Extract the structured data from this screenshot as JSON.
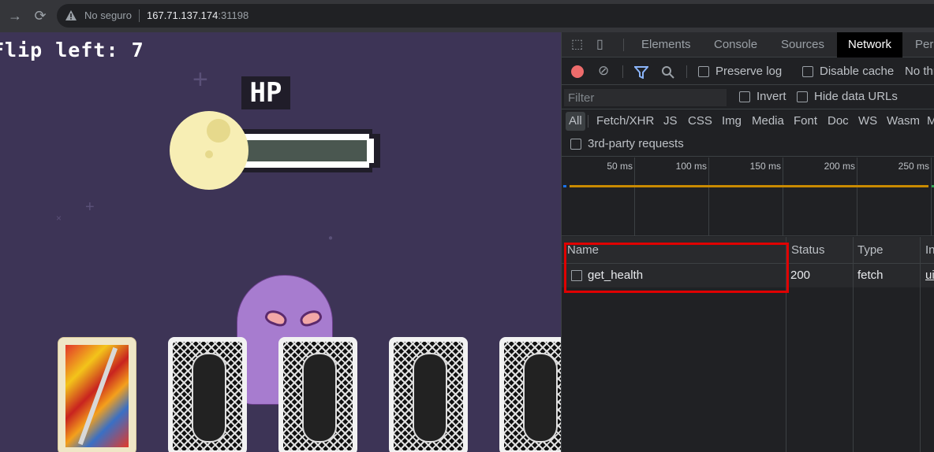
{
  "browser": {
    "security_text": "No seguro",
    "url_host": "167.71.137.174",
    "url_port": ":31198",
    "forward_icon": "arrow-forward-icon",
    "reload_icon": "reload-icon",
    "warning_icon": "warning-triangle-icon"
  },
  "game": {
    "flip_text": "Flip left: 7",
    "hp_label": "HP",
    "hp_fill_fraction": 1.0,
    "cards": [
      {
        "state": "face-up"
      },
      {
        "state": "face-down"
      },
      {
        "state": "face-down"
      },
      {
        "state": "face-down"
      },
      {
        "state": "face-down"
      }
    ]
  },
  "devtools": {
    "tabs": [
      {
        "label": "Elements"
      },
      {
        "label": "Console"
      },
      {
        "label": "Sources"
      },
      {
        "label": "Network",
        "active": true
      },
      {
        "label": "Per"
      }
    ],
    "toolbar": {
      "preserve_log": "Preserve log",
      "disable_cache": "Disable cache",
      "throttle": "No thr"
    },
    "filter": {
      "placeholder": "Filter",
      "invert": "Invert",
      "hide_data_urls": "Hide data URLs"
    },
    "types": [
      "All",
      "Fetch/XHR",
      "JS",
      "CSS",
      "Img",
      "Media",
      "Font",
      "Doc",
      "WS",
      "Wasm",
      "M"
    ],
    "third_party": "3rd-party requests",
    "timeline_ticks": [
      "50 ms",
      "100 ms",
      "150 ms",
      "200 ms",
      "250 ms"
    ],
    "table": {
      "headers": {
        "name": "Name",
        "status": "Status",
        "type": "Type",
        "initiator": "In"
      },
      "rows": [
        {
          "name": "get_health",
          "status": "200",
          "type": "fetch",
          "initiator": "ui"
        }
      ]
    }
  }
}
